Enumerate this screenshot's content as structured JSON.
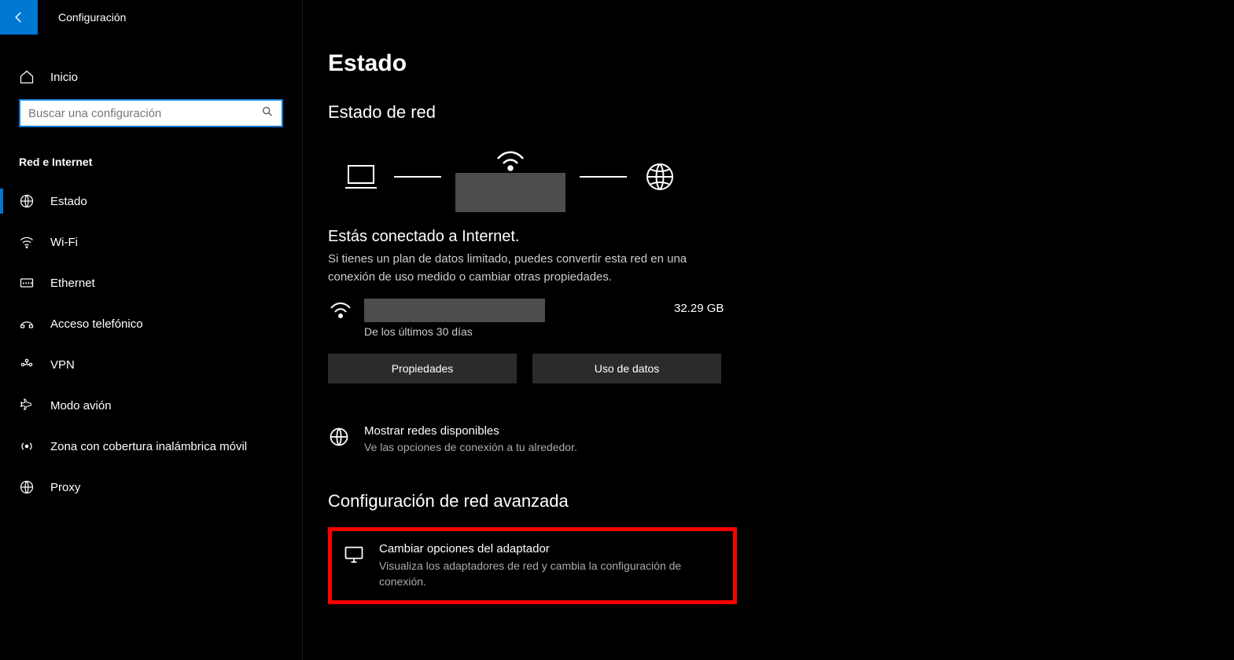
{
  "app_title": "Configuración",
  "home_label": "Inicio",
  "search": {
    "placeholder": "Buscar una configuración"
  },
  "category": "Red e Internet",
  "nav": [
    {
      "label": "Estado",
      "icon": "globe-grid",
      "active": true
    },
    {
      "label": "Wi-Fi",
      "icon": "wifi",
      "active": false
    },
    {
      "label": "Ethernet",
      "icon": "ethernet",
      "active": false
    },
    {
      "label": "Acceso telefónico",
      "icon": "dialup",
      "active": false
    },
    {
      "label": "VPN",
      "icon": "vpn",
      "active": false
    },
    {
      "label": "Modo avión",
      "icon": "airplane",
      "active": false
    },
    {
      "label": "Zona con cobertura inalámbrica móvil",
      "icon": "hotspot",
      "active": false
    },
    {
      "label": "Proxy",
      "icon": "globe-grid",
      "active": false
    }
  ],
  "main": {
    "page_title": "Estado",
    "section1": "Estado de red",
    "connected_title": "Estás conectado a Internet.",
    "connected_desc": "Si tienes un plan de datos limitado, puedes convertir esta red en una conexión de uso medido o cambiar otras propiedades.",
    "usage_sub": "De los últimos 30 días",
    "usage_amount": "32.29 GB",
    "btn_props": "Propiedades",
    "btn_data": "Uso de datos",
    "show_networks_title": "Mostrar redes disponibles",
    "show_networks_desc": "Ve las opciones de conexión a tu alrededor.",
    "section2": "Configuración de red avanzada",
    "adapter_title": "Cambiar opciones del adaptador",
    "adapter_desc": "Visualiza los adaptadores de red y cambia la configuración de conexión."
  }
}
